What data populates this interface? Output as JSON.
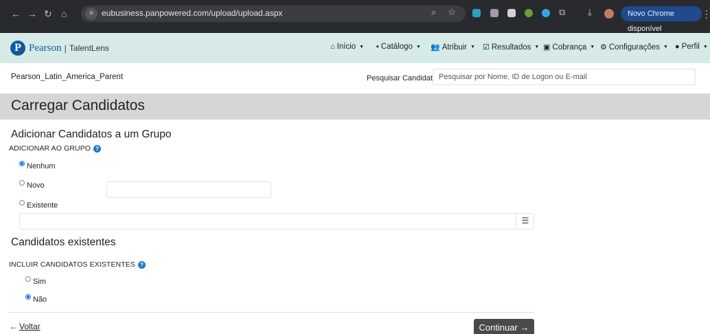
{
  "browser": {
    "url": "eubusiness.panpowered.com/upload/upload.aspx",
    "update_pill": "Novo Chrome disponível"
  },
  "header": {
    "brand": "Pearson",
    "brand_sub": "TalentLens",
    "menu": [
      {
        "label": "Início",
        "icon": "home-icon"
      },
      {
        "label": "Catálogo",
        "icon": "book-icon"
      },
      {
        "label": "Atribuir",
        "icon": "users-icon"
      },
      {
        "label": "Resultados",
        "icon": "check-square-icon"
      },
      {
        "label": "Cobrança",
        "icon": "money-icon"
      },
      {
        "label": "Configurações",
        "icon": "gears-icon"
      },
      {
        "label": "Perfil",
        "icon": "user-icon"
      }
    ]
  },
  "account": {
    "name": "Pearson_Latin_America_Parent",
    "search_label": "Pesquisar Candidatos",
    "search_placeholder": "Pesquisar por Nome, ID de Logon ou E-mail"
  },
  "page": {
    "title": "Carregar Candidatos",
    "group_section": {
      "heading": "Adicionar Candidatos a um Grupo",
      "label": "ADICIONAR AO GRUPO",
      "options": [
        "Nenhum",
        "Novo",
        "Existente"
      ],
      "selected": "Nenhum"
    },
    "existing_section": {
      "heading": "Candidatos existentes",
      "label": "INCLUIR CANDIDATOS EXISTENTES",
      "options": [
        "Sim",
        "Não"
      ],
      "selected": "Não"
    },
    "back_label": "Voltar",
    "continue_label": "Continuar"
  }
}
